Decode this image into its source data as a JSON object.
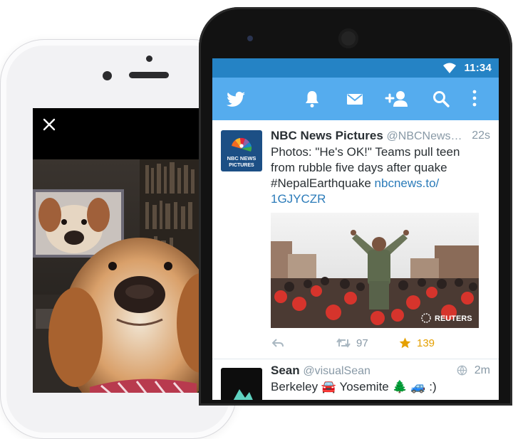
{
  "status_bar": {
    "time": "11:34"
  },
  "app_bar": {
    "icons": [
      "twitter-bird-icon",
      "notifications-bell-icon",
      "messages-icon",
      "add-user-icon",
      "search-icon",
      "more-vert-icon"
    ]
  },
  "viewer": {
    "close_icon": "close-icon"
  },
  "tweets": [
    {
      "name": "NBC News Pictures",
      "handle": "@NBCNews…",
      "time": "22s",
      "text_plain": "Photos: \"He's OK!\" Teams pull teen from rubble five days after quake #NepalEarthquake ",
      "link": "nbcnews.to/ 1GJYCZR",
      "avatar_label_1": "NBC NEWS",
      "avatar_label_2": "PICTURES",
      "media_credit": "REUTERS",
      "retweets": "97",
      "favorites": "139"
    },
    {
      "name": "Sean",
      "handle": "@visualSean",
      "time": "2m",
      "text": "Berkeley 🚘 Yosemite 🌲 🚙 :)"
    }
  ],
  "colors": {
    "status_bar": "#2583c5",
    "app_bar": "#55acee",
    "link": "#2b7bb9",
    "favorite": "#e5a000",
    "muted": "#8899a6"
  }
}
